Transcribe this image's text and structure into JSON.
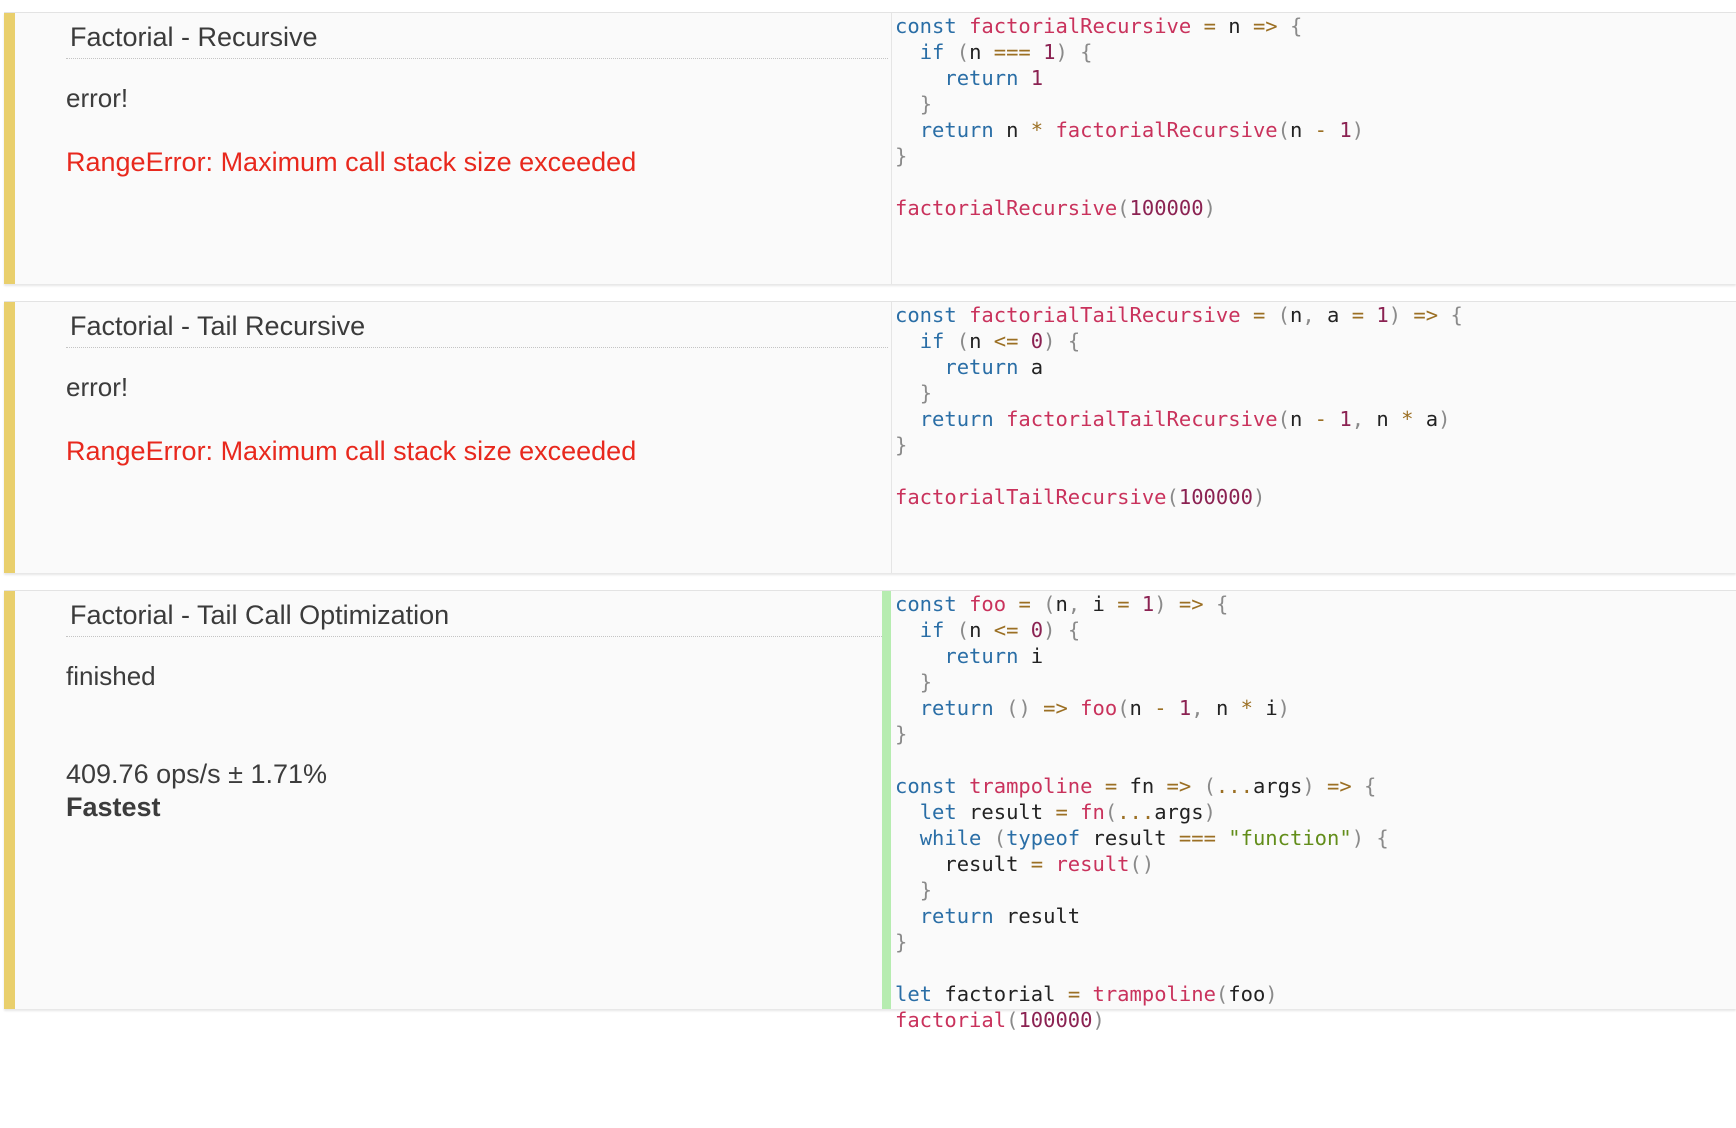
{
  "tests": [
    {
      "title": "Factorial - Recursive",
      "status": "error!",
      "error": "RangeError: Maximum call stack size exceeded",
      "code": [
        "const factorialRecursive = n => {",
        "  if (n === 1) {",
        "    return 1",
        "  }",
        "  return n * factorialRecursive(n - 1)",
        "}",
        "",
        "factorialRecursive(100000)"
      ]
    },
    {
      "title": "Factorial - Tail Recursive",
      "status": "error!",
      "error": "RangeError: Maximum call stack size exceeded",
      "code": [
        "const factorialTailRecursive = (n, a = 1) => {",
        "  if (n <= 0) {",
        "    return a",
        "  }",
        "  return factorialTailRecursive(n - 1, n * a)",
        "}",
        "",
        "factorialTailRecursive(100000)"
      ]
    },
    {
      "title": "Factorial - Tail Call Optimization",
      "status": "finished",
      "ops": "409.76 ops/s ± 1.71%",
      "badge": "Fastest",
      "code": [
        "const foo = (n, i = 1) => {",
        "  if (n <= 0) {",
        "    return i",
        "  }",
        "  return () => foo(n - 1, n * i)",
        "}",
        "",
        "const trampoline = fn => (...args) => {",
        "  let result = fn(...args)",
        "  while (typeof result === \"function\") {",
        "    result = result()",
        "  }",
        "  return result",
        "}",
        "",
        "let factorial = trampoline(foo)",
        "factorial(100000)"
      ]
    }
  ],
  "colors": {
    "stripe": "#e9cf6c",
    "error": "#e8281d",
    "success_bar": "#b6ecb0",
    "keyword": "#2a6ea6",
    "function_name": "#c9325c",
    "number": "#8b2252",
    "operator": "#9b6f23",
    "string": "#628d1a"
  }
}
